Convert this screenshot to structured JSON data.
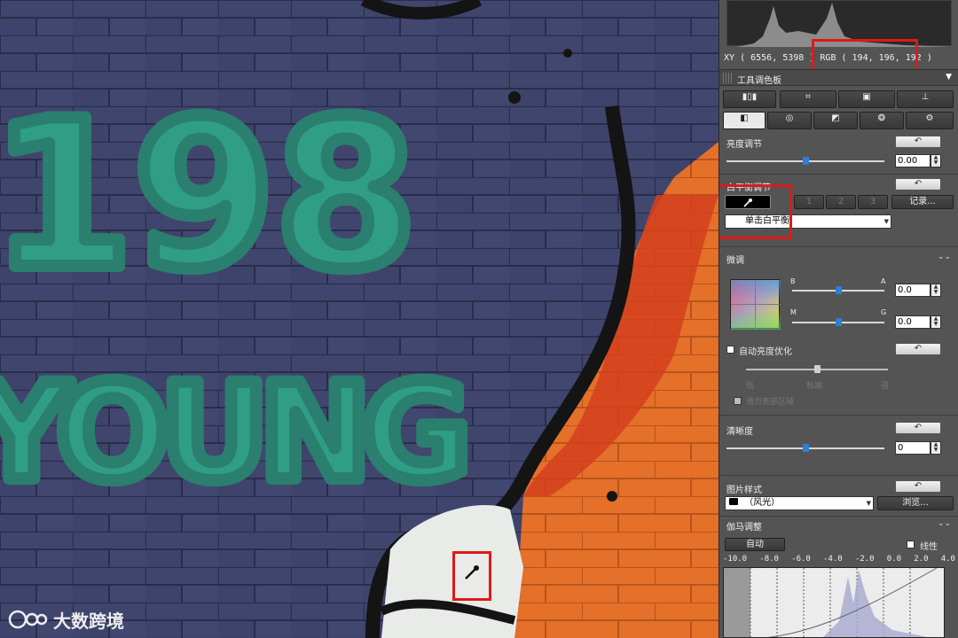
{
  "readout": {
    "xy_label": "XY",
    "xy_value": "( 6556,  5398 )",
    "rgb_label": "RGB",
    "rgb_value": "( 194,  196,  192 )"
  },
  "tool_palette": {
    "title": "工具调色板",
    "top_tools": [
      "rgb-levels-icon",
      "crop-icon",
      "image-box-icon",
      "stamp-icon"
    ],
    "tabs": [
      "basic-adjust-icon",
      "lens-icon",
      "curve-icon",
      "color-icon",
      "gear-icon"
    ]
  },
  "brightness": {
    "label": "亮度调节",
    "value": "0.00",
    "level": 0.0,
    "reset_label": "↶"
  },
  "white_balance": {
    "label": "白平衡调节",
    "slot_labels": [
      "1",
      "2",
      "3"
    ],
    "record_label": "记录...",
    "preset_value": "单击白平衡",
    "reset_label": "↶"
  },
  "fine_tune": {
    "label": "微调",
    "b_label": "B",
    "a_label": "A",
    "m_label": "M",
    "g_label": "G",
    "ba_value": "0.0",
    "mg_value": "0.0"
  },
  "auto_lighting": {
    "label": "自动亮度优化",
    "checked": false,
    "levels": [
      "低",
      "标准",
      "强"
    ],
    "sub_option": "请勿亮部区域",
    "reset_label": "↶"
  },
  "sharpness": {
    "label": "清晰度",
    "value": "0",
    "reset_label": "↶"
  },
  "picture_style": {
    "label": "图片样式",
    "value": "（风光）",
    "browse_label": "浏览...",
    "reset_label": "↶"
  },
  "gamma": {
    "label": "伽马调整",
    "auto_label": "自动",
    "linear_label": "线性",
    "scale": [
      "-10.0",
      "-8.0",
      "-6.0",
      "-4.0",
      "-2.0",
      "0.0",
      "2.0",
      "4.0"
    ]
  },
  "photo": {
    "graffiti_number": "198",
    "graffiti_word": "YOUNG"
  },
  "watermark": {
    "brand": "大数跨境"
  },
  "colors": {
    "brick_blue": "#3b4067",
    "graffiti_green": "#2f9e84",
    "orange": "#e5722c",
    "highlight_red": "#e01818",
    "slider_blue": "#2f7fd6"
  }
}
